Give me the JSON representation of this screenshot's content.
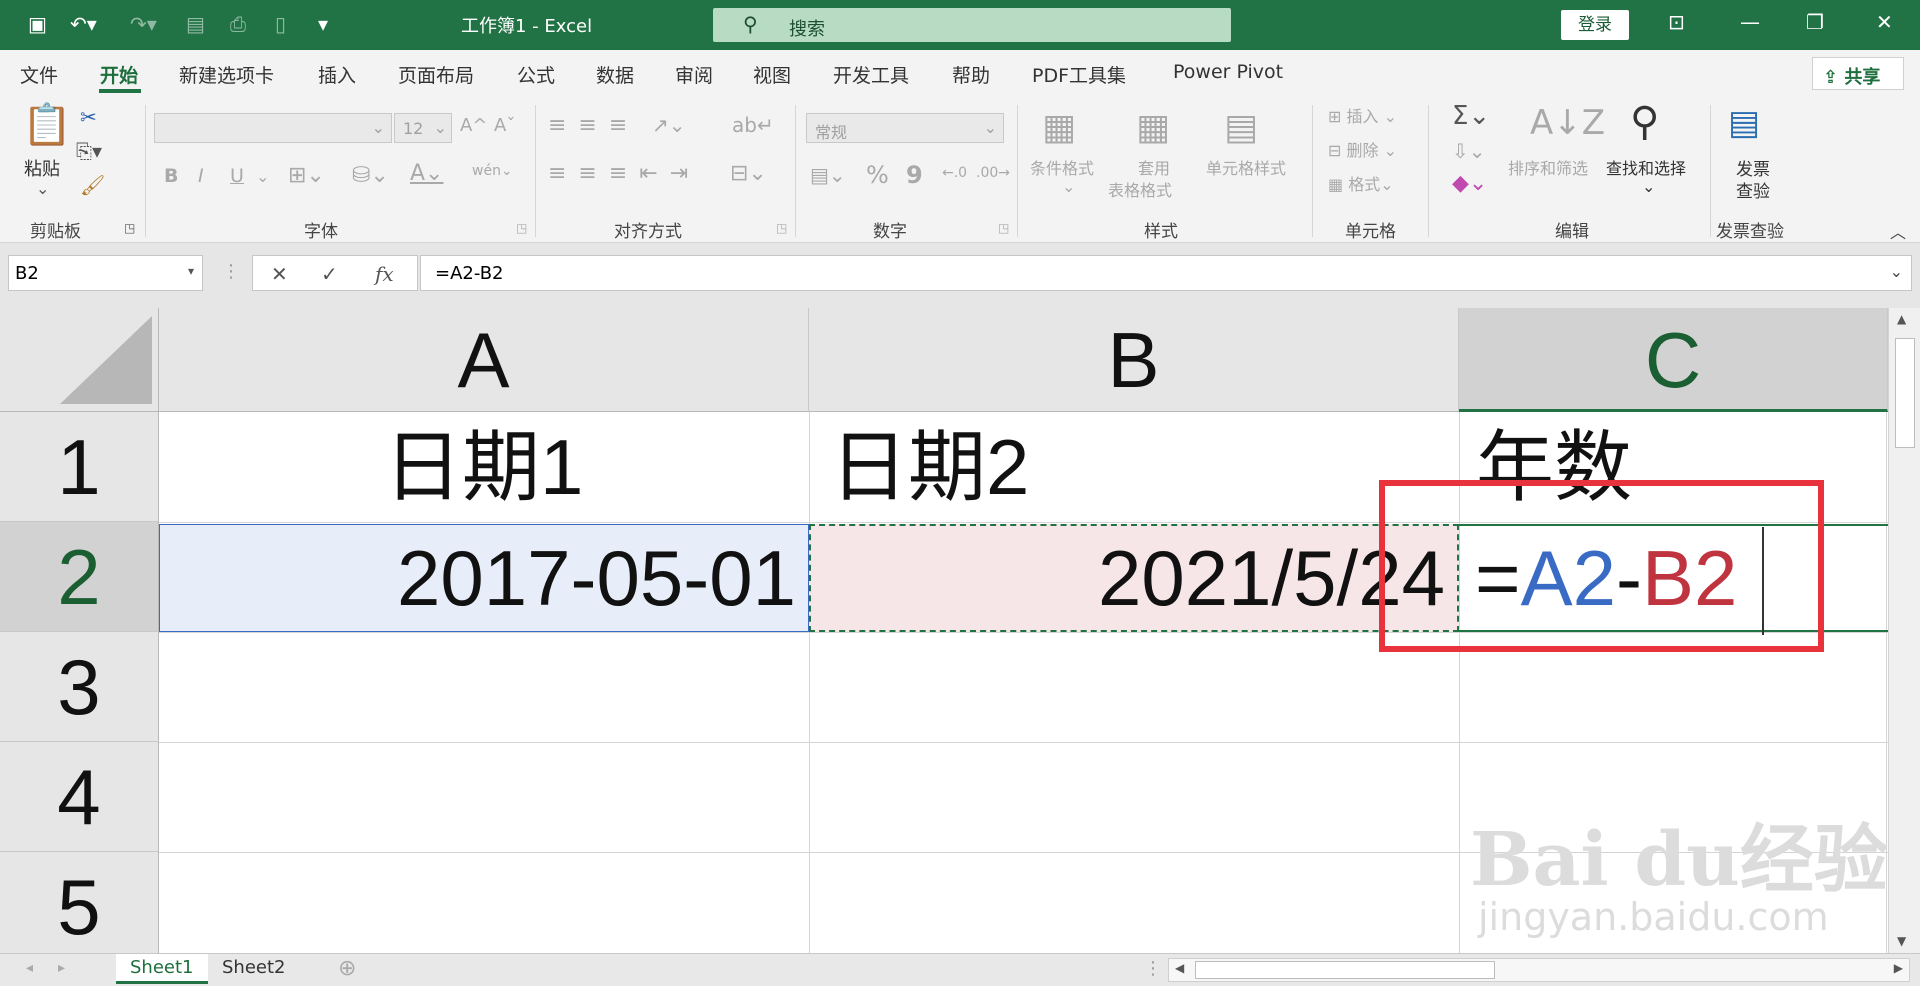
{
  "app": {
    "window_title": "工作簿1  -  Excel",
    "search_placeholder": "搜索",
    "login_label": "登录"
  },
  "menu": {
    "items": [
      "文件",
      "开始",
      "新建选项卡",
      "插入",
      "页面布局",
      "公式",
      "数据",
      "审阅",
      "视图",
      "开发工具",
      "帮助",
      "PDF工具集",
      "Power Pivot"
    ],
    "active": "开始",
    "share_label": "共享"
  },
  "ribbon": {
    "clipboard": {
      "paste_label": "粘贴",
      "group_label": "剪贴板"
    },
    "font": {
      "size_value": "12",
      "group_label": "字体",
      "bold": "B",
      "italic": "I",
      "underline": "U"
    },
    "alignment": {
      "group_label": "对齐方式"
    },
    "number": {
      "format_value": "常规",
      "group_label": "数字",
      "percent": "%",
      "comma": "9"
    },
    "styles": {
      "conditional": "条件格式",
      "table_line1": "套用",
      "table_line2": "表格格式",
      "cell_styles": "单元格样式",
      "group_label": "样式"
    },
    "cells": {
      "insert": "插入",
      "delete": "删除",
      "format": "格式",
      "group_label": "单元格"
    },
    "editing": {
      "sort_filter": "排序和筛选",
      "find_select": "查找和选择",
      "group_label": "编辑"
    },
    "invoice": {
      "line1": "发票",
      "line2": "查验",
      "group_label": "发票查验"
    }
  },
  "formula_bar": {
    "name_box": "B2",
    "formula": "=A2-B2"
  },
  "grid": {
    "columns": [
      "A",
      "B",
      "C"
    ],
    "rows": [
      "1",
      "2",
      "3",
      "4",
      "5"
    ],
    "active_column": "C",
    "active_row": "2",
    "cells": {
      "A1": "日期1",
      "B1": "日期2",
      "C1": "年数",
      "A2": "2017-05-01",
      "B2": "2021/5/24",
      "C2_eq": "=",
      "C2_ref1": "A2",
      "C2_op": "-",
      "C2_ref2": "B2"
    }
  },
  "sheets": {
    "tabs": [
      "Sheet1",
      "Sheet2"
    ],
    "active": "Sheet1"
  },
  "colors": {
    "excel_green": "#217346",
    "ref_blue": "#3a6bc4",
    "ref_red": "#c0343f",
    "highlight_red": "#e8323c"
  },
  "watermark": {
    "line1": "Bai du经验",
    "line2": "jingyan.baidu.com"
  }
}
